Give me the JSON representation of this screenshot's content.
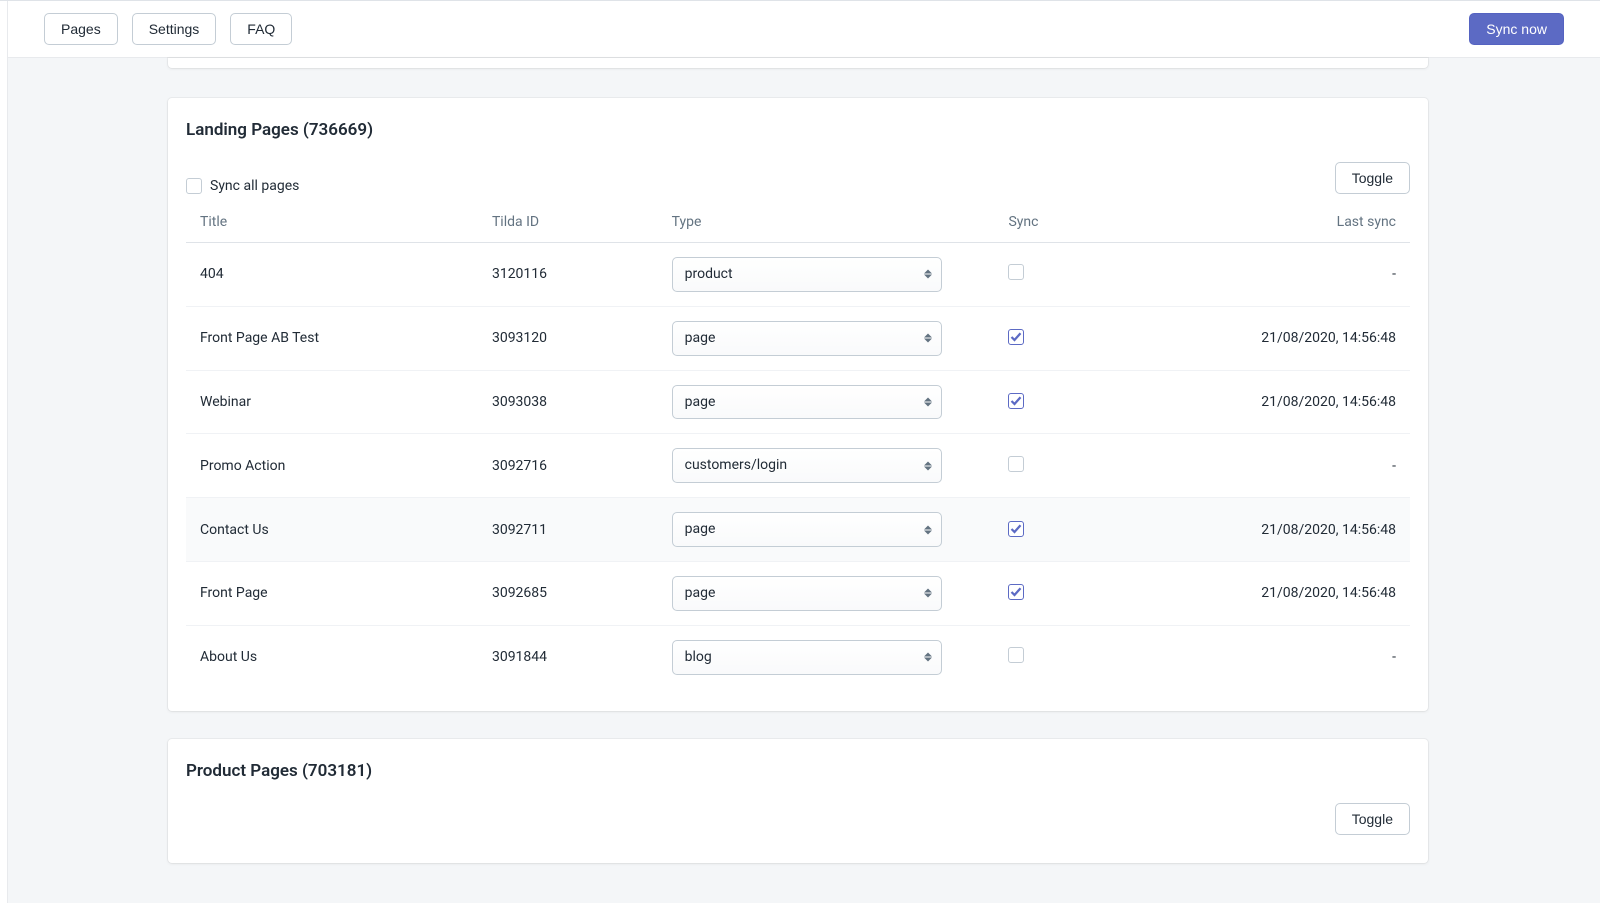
{
  "topbar": {
    "pages": "Pages",
    "settings": "Settings",
    "faq": "FAQ",
    "sync_now": "Sync now"
  },
  "landing_card": {
    "title": "Landing Pages (736669)",
    "toggle": "Toggle",
    "sync_all_label": "Sync all pages",
    "sync_all_checked": false,
    "columns": {
      "title": "Title",
      "tilda_id": "Tilda ID",
      "type": "Type",
      "sync": "Sync",
      "last_sync": "Last sync"
    },
    "type_options": [
      "product",
      "page",
      "customers/login",
      "blog"
    ],
    "rows": [
      {
        "title": "404",
        "tilda_id": "3120116",
        "type": "product",
        "sync": false,
        "last_sync": "-",
        "hover": false
      },
      {
        "title": "Front Page AB Test",
        "tilda_id": "3093120",
        "type": "page",
        "sync": true,
        "last_sync": "21/08/2020, 14:56:48",
        "hover": false
      },
      {
        "title": "Webinar",
        "tilda_id": "3093038",
        "type": "page",
        "sync": true,
        "last_sync": "21/08/2020, 14:56:48",
        "hover": false
      },
      {
        "title": "Promo Action",
        "tilda_id": "3092716",
        "type": "customers/login",
        "sync": false,
        "last_sync": "-",
        "hover": false
      },
      {
        "title": "Contact Us",
        "tilda_id": "3092711",
        "type": "page",
        "sync": true,
        "last_sync": "21/08/2020, 14:56:48",
        "hover": true
      },
      {
        "title": "Front Page",
        "tilda_id": "3092685",
        "type": "page",
        "sync": true,
        "last_sync": "21/08/2020, 14:56:48",
        "hover": false
      },
      {
        "title": "About Us",
        "tilda_id": "3091844",
        "type": "blog",
        "sync": false,
        "last_sync": "-",
        "hover": false
      }
    ]
  },
  "product_card": {
    "title": "Product Pages (703181)",
    "toggle": "Toggle"
  }
}
